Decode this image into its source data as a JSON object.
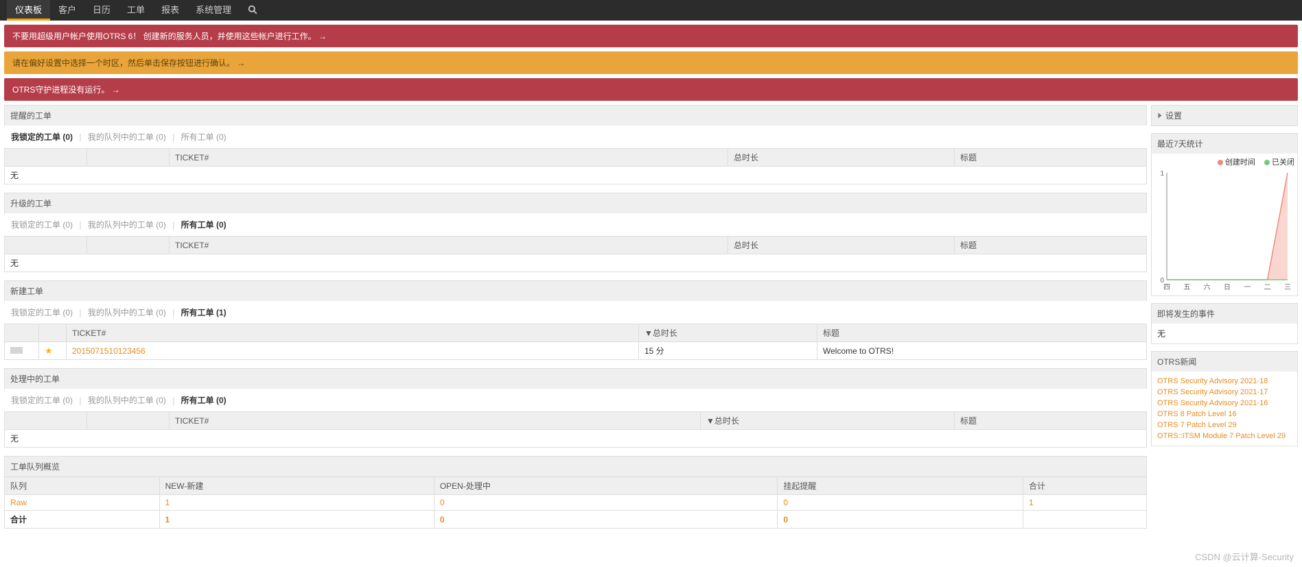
{
  "nav": {
    "tabs": [
      "仪表板",
      "客户",
      "日历",
      "工单",
      "报表",
      "系统管理"
    ],
    "active_index": 0
  },
  "banners": [
    {
      "style": "red",
      "text": "不要用超级用户帐户使用OTRS 6！ 创建新的服务人员，并使用这些帐户进行工作。 →"
    },
    {
      "style": "orange",
      "text": "请在偏好设置中选择一个时区，然后单击保存按钮进行确认。 →"
    },
    {
      "style": "red",
      "text": "OTRS守护进程没有运行。 →"
    }
  ],
  "widgets": {
    "reminder": {
      "title": "提醒的工单",
      "filters": [
        {
          "label": "我锁定的工单 (0)",
          "active": true
        },
        {
          "label": "我的队列中的工单 (0)",
          "active": false
        },
        {
          "label": "所有工单 (0)",
          "active": false
        }
      ],
      "columns": [
        "",
        "",
        "TICKET#",
        "总时长",
        "标题"
      ],
      "none_text": "无"
    },
    "escalated": {
      "title": "升级的工单",
      "filters": [
        {
          "label": "我锁定的工单 (0)",
          "active": false
        },
        {
          "label": "我的队列中的工单 (0)",
          "active": false
        },
        {
          "label": "所有工单 (0)",
          "active": true
        }
      ],
      "columns": [
        "",
        "",
        "TICKET#",
        "总时长",
        "标题"
      ],
      "none_text": "无"
    },
    "newticket": {
      "title": "新建工单",
      "filters": [
        {
          "label": "我锁定的工单 (0)",
          "active": false
        },
        {
          "label": "我的队列中的工单 (0)",
          "active": false
        },
        {
          "label": "所有工单 (1)",
          "active": true
        }
      ],
      "columns": [
        "",
        "",
        "TICKET#",
        "▼总时长",
        "标题"
      ],
      "row": {
        "ticket": "2015071510123456",
        "age": "15 分",
        "subject": "Welcome to OTRS!"
      }
    },
    "open": {
      "title": "处理中的工单",
      "filters": [
        {
          "label": "我锁定的工单 (0)",
          "active": false
        },
        {
          "label": "我的队列中的工单 (0)",
          "active": false
        },
        {
          "label": "所有工单 (0)",
          "active": true
        }
      ],
      "columns": [
        "",
        "",
        "TICKET#",
        "▼总时长",
        "标题"
      ],
      "none_text": "无"
    },
    "queueoverview": {
      "title": "工单队列概览",
      "columns": [
        "队列",
        "NEW-新建",
        "OPEN-处理中",
        "挂起提醒",
        "合计"
      ],
      "rows": [
        {
          "queue": "Raw",
          "new": "1",
          "open": "0",
          "pending": "0",
          "total": "1",
          "link": true
        },
        {
          "queue": "合计",
          "new": "1",
          "open": "0",
          "pending": "0",
          "total": "",
          "link": false,
          "bold": true
        }
      ]
    }
  },
  "sidebar": {
    "settings_label": "设置",
    "stats7": {
      "title": "最近7天统计",
      "legend": {
        "created": "创建时间",
        "closed": "已关闭"
      }
    },
    "upcoming": {
      "title": "即将发生的事件",
      "none": "无"
    },
    "news": {
      "title": "OTRS新闻",
      "items": [
        "OTRS Security Advisory 2021-18",
        "OTRS Security Advisory 2021-17",
        "OTRS Security Advisory 2021-16",
        "OTRS 8 Patch Level 16",
        "OTRS 7 Patch Level 29",
        "OTRS::ITSM Module 7 Patch Level 29"
      ]
    }
  },
  "watermark": "CSDN @云计算-Security",
  "chart_data": {
    "type": "area",
    "categories": [
      "四",
      "五",
      "六",
      "日",
      "一",
      "二",
      "三"
    ],
    "series": [
      {
        "name": "创建时间",
        "color": "#f08a7a",
        "values": [
          0,
          0,
          0,
          0,
          0,
          0,
          1
        ]
      },
      {
        "name": "已关闭",
        "color": "#7bc97b",
        "values": [
          0,
          0,
          0,
          0,
          0,
          0,
          0
        ]
      }
    ],
    "ylim": [
      0,
      1
    ],
    "yticks": [
      0,
      1
    ]
  }
}
